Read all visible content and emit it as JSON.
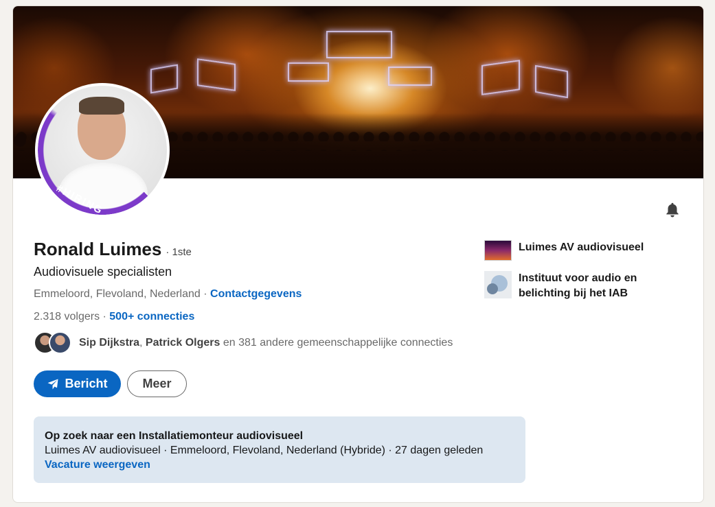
{
  "profile": {
    "name": "Ronald Luimes",
    "degree": "· 1ste",
    "headline": "Audiovisuele specialisten",
    "location": "Emmeloord, Flevoland, Nederland",
    "location_sep": " · ",
    "contact_link": "Contactgegevens",
    "followers": "2.318 volgers",
    "followers_sep": " · ",
    "connections_link": "500+ connecties",
    "hiring_badge": "#HIRING"
  },
  "mutual": {
    "name1": "Sip Dijkstra",
    "sep": ", ",
    "name2": "Patrick Olgers",
    "rest": " en 381 andere gemeenschappelijke connecties"
  },
  "actions": {
    "message_label": "Bericht",
    "more_label": "Meer"
  },
  "job": {
    "title": "Op zoek naar een Installatiemonteur audiovisueel",
    "meta": "Luimes AV audiovisueel · Emmeloord, Flevoland, Nederland (Hybride) · 27 dagen geleden",
    "link": "Vacature weergeven"
  },
  "sidebar": {
    "items": [
      {
        "label": "Luimes AV audiovisueel",
        "icon": "company-logo-icon"
      },
      {
        "label": "Instituut voor audio en belichting bij het IAB",
        "icon": "school-logo-icon"
      }
    ]
  },
  "colors": {
    "accent": "#0a66c2",
    "hiring": "#7c3ac9",
    "job_bg": "#dde7f1",
    "page_bg": "#f4f2ee"
  }
}
